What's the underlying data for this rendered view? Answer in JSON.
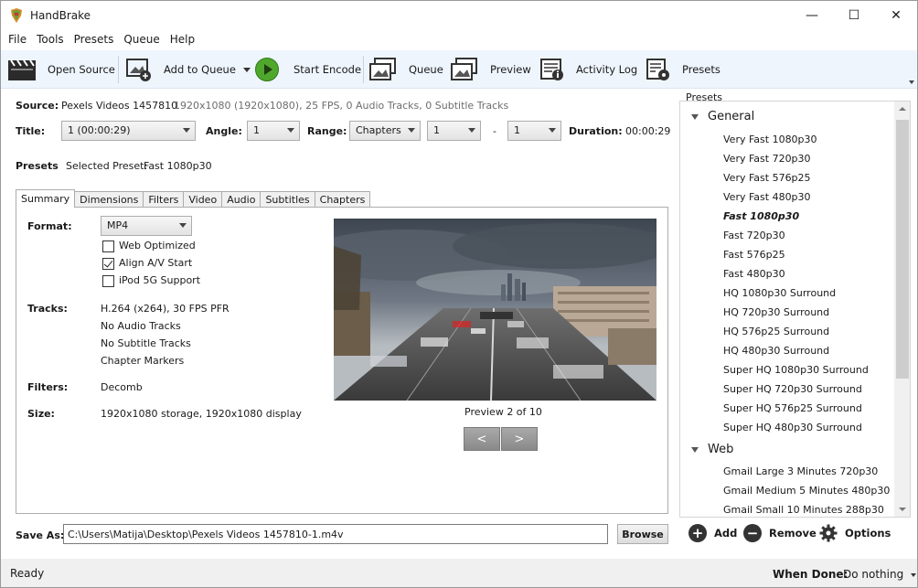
{
  "window": {
    "title": "HandBrake",
    "controls": {
      "minimize": "—",
      "maximize": "☐",
      "close": "✕"
    }
  },
  "menu": [
    "File",
    "Tools",
    "Presets",
    "Queue",
    "Help"
  ],
  "toolbar": {
    "open_source": "Open Source",
    "add_to_queue": "Add to Queue",
    "start_encode": "Start Encode",
    "queue": "Queue",
    "preview": "Preview",
    "activity_log": "Activity Log",
    "presets": "Presets"
  },
  "source": {
    "label": "Source:",
    "name": "Pexels Videos 1457810",
    "details": "1920x1080 (1920x1080), 25 FPS, 0 Audio Tracks, 0 Subtitle Tracks"
  },
  "selection": {
    "title_label": "Title:",
    "title_value": "1 (00:00:29)",
    "angle_label": "Angle:",
    "angle_value": "1",
    "range_label": "Range:",
    "range_type": "Chapters",
    "range_start": "1",
    "range_sep": "-",
    "range_end": "1",
    "duration_label": "Duration:",
    "duration_value": "00:00:29"
  },
  "preset_line": {
    "label": "Presets",
    "selected_label": "Selected Preset:",
    "selected_value": "Fast 1080p30"
  },
  "tabs": [
    "Summary",
    "Dimensions",
    "Filters",
    "Video",
    "Audio",
    "Subtitles",
    "Chapters"
  ],
  "summary": {
    "format_label": "Format:",
    "format_value": "MP4",
    "web_optimized": "Web Optimized",
    "web_optimized_checked": false,
    "align_av": "Align A/V Start",
    "align_av_checked": true,
    "ipod": "iPod 5G Support",
    "ipod_checked": false,
    "tracks_label": "Tracks:",
    "tracks": [
      "H.264 (x264), 30 FPS PFR",
      "No Audio Tracks",
      "No Subtitle Tracks",
      "Chapter Markers"
    ],
    "filters_label": "Filters:",
    "filters_value": "Decomb",
    "size_label": "Size:",
    "size_value": "1920x1080 storage, 1920x1080 display",
    "preview_caption": "Preview 2 of 10",
    "prev": "<",
    "next": ">"
  },
  "save": {
    "label": "Save As:",
    "path": "C:\\Users\\Matija\\Desktop\\Pexels Videos 1457810-1.m4v",
    "browse": "Browse"
  },
  "presets_panel": {
    "title": "Presets",
    "groups": [
      {
        "name": "General",
        "items": [
          "Very Fast 1080p30",
          "Very Fast 720p30",
          "Very Fast 576p25",
          "Very Fast 480p30",
          "Fast 1080p30",
          "Fast 720p30",
          "Fast 576p25",
          "Fast 480p30",
          "HQ 1080p30 Surround",
          "HQ 720p30 Surround",
          "HQ 576p25 Surround",
          "HQ 480p30 Surround",
          "Super HQ 1080p30 Surround",
          "Super HQ 720p30 Surround",
          "Super HQ 576p25 Surround",
          "Super HQ 480p30 Surround"
        ]
      },
      {
        "name": "Web",
        "items": [
          "Gmail Large 3 Minutes 720p30",
          "Gmail Medium 5 Minutes 480p30",
          "Gmail Small 10 Minutes 288p30"
        ]
      }
    ],
    "selected": "Fast 1080p30",
    "add": "Add",
    "remove": "Remove",
    "options": "Options"
  },
  "status": {
    "text": "Ready",
    "when_done_label": "When Done:",
    "when_done_value": "Do nothing"
  }
}
